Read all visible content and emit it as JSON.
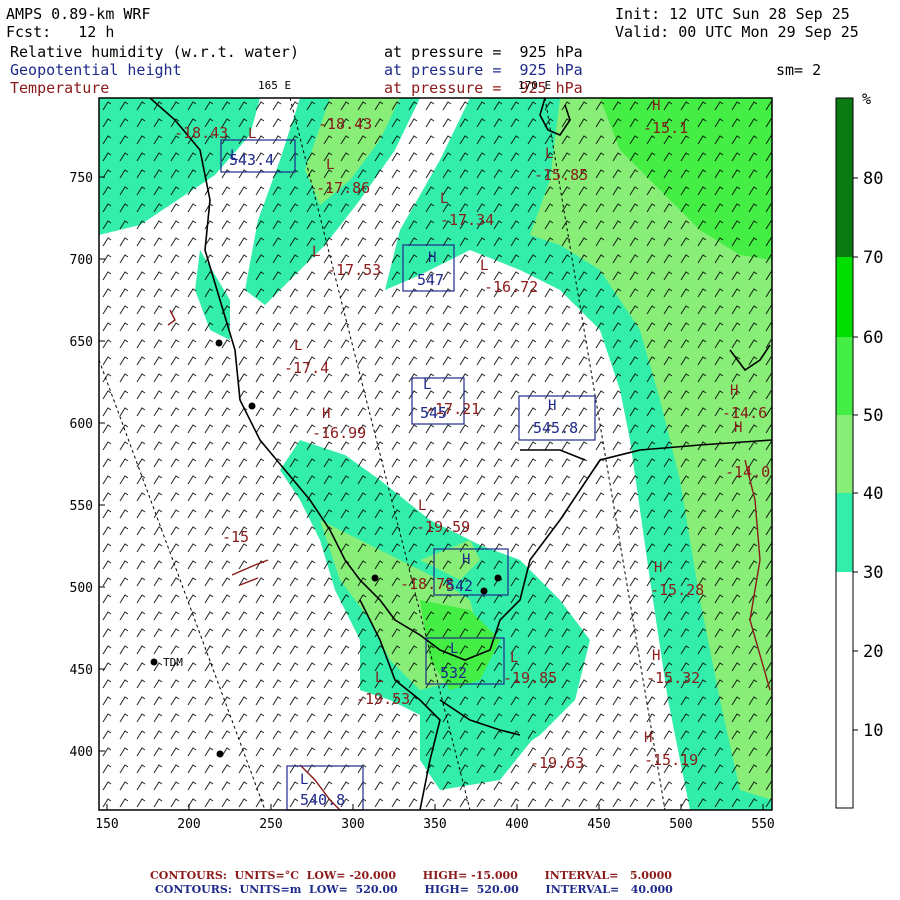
{
  "header": {
    "model": "AMPS 0.89-km WRF",
    "forecast": "Fcst:   12 h",
    "init": "Init: 12 UTC Sun 28 Sep 25",
    "valid": "Valid: 00 UTC Mon 29 Sep 25",
    "fields": [
      {
        "name": "Relative humidity (w.r.t. water)",
        "level": "at pressure =  925 hPa",
        "color": "#000000"
      },
      {
        "name": "Geopotential height",
        "level": "at pressure =  925 hPa",
        "color": "#1e2a8a"
      },
      {
        "name": "Temperature",
        "level": "at pressure =  925 hPa",
        "color": "#8b1a1a"
      }
    ],
    "smoothing": "sm= 2",
    "meridian_labels": [
      "165 E",
      "170 E"
    ]
  },
  "map": {
    "x_ticks": [
      "150",
      "200",
      "250",
      "300",
      "350",
      "400",
      "450",
      "500",
      "550"
    ],
    "y_ticks": [
      "750",
      "700",
      "650",
      "600",
      "550",
      "500",
      "450",
      "400"
    ],
    "station_label": "TDM",
    "temperature_labels": [
      "-18.43",
      "-18.43",
      "-17.86",
      "-17.34",
      "-17.53",
      "-16.72",
      "-17.4",
      "-16.99",
      "-15",
      "-15.85",
      "-15.1",
      "-14.6",
      "-14.0",
      "-15.28",
      "-15.32",
      "-15.19",
      "-19.59",
      "-19.53",
      "-19.85",
      "-19.63",
      "-18.78",
      "-17.21"
    ],
    "height_labels": [
      "543.4",
      "547",
      "545",
      "545.8",
      "542",
      "532",
      "540.8"
    ]
  },
  "colorbar": {
    "unit": "%",
    "labels": [
      "80",
      "70",
      "60",
      "50",
      "40",
      "30",
      "20",
      "10"
    ],
    "colors": {
      "r70_100": "#0b7a12",
      "r60_70": "#00dd00",
      "r50_60": "#44ee44",
      "r40_50": "#88ee77",
      "r30_40": "#33eeaa",
      "r0_30": "#ffffff"
    }
  },
  "footer": {
    "temp_line": "CONTOURS:  UNITS=°C  LOW= -20.000       HIGH= -15.000       INTERVAL=   5.0000",
    "height_line": "CONTOURS:  UNITS=m  LOW=  520.00       HIGH=  520.00       INTERVAL=   40.000"
  }
}
